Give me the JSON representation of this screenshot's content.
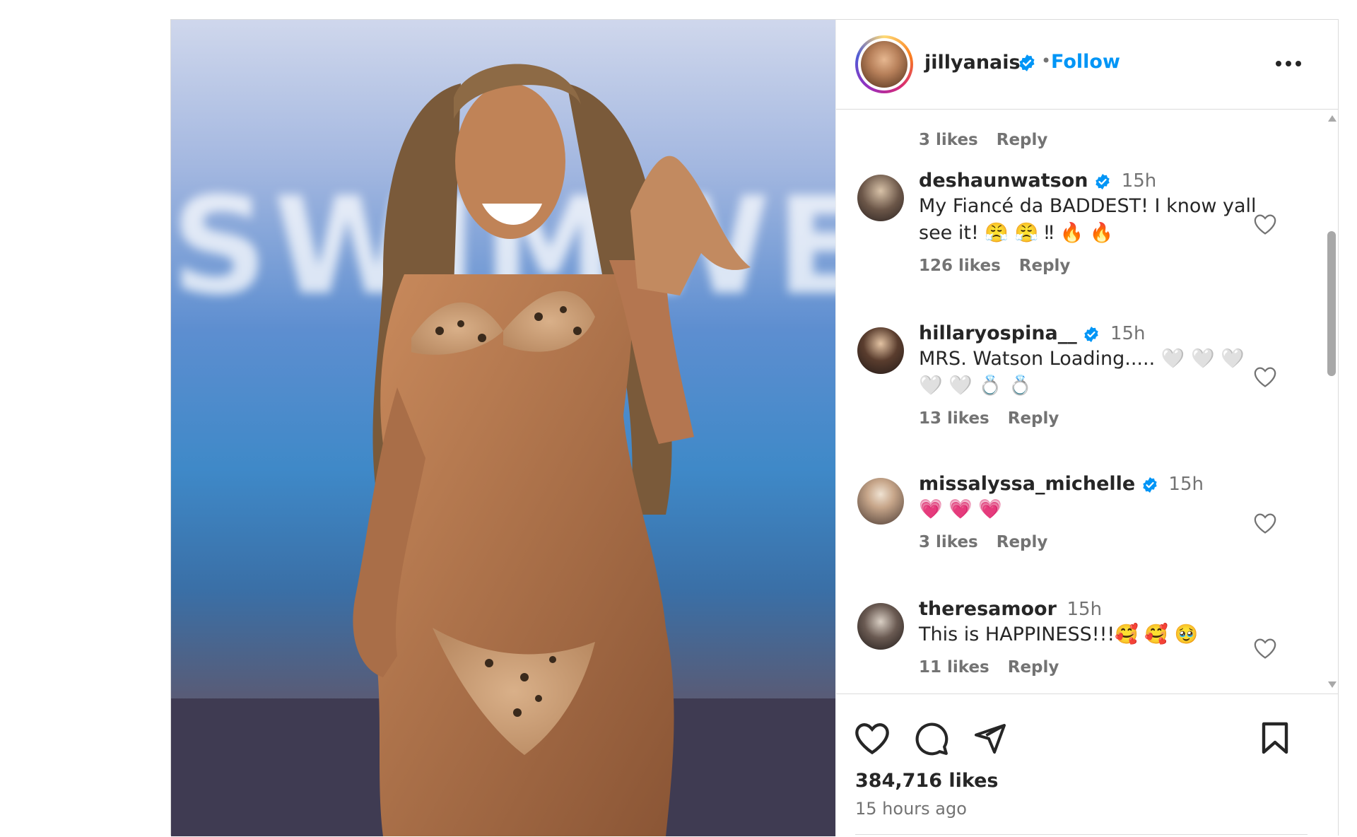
{
  "post": {
    "username": "jillyanais",
    "separator": "•",
    "follow_label": "Follow",
    "more_icon": "more-horizontal-icon",
    "media_text": "SWIMWEEK"
  },
  "top_meta": {
    "likes": "3 likes",
    "reply": "Reply"
  },
  "comments": [
    {
      "username": "deshaunwatson",
      "verified": true,
      "time": "15h",
      "text_line1": "My Fiancé da BADDEST! I know yall",
      "text_line2": "see it! 😤 😤 ‼ 🔥 🔥",
      "likes": "126 likes",
      "reply": "Reply"
    },
    {
      "username": "hillaryospina__",
      "verified": true,
      "time": "15h",
      "text_line1": "MRS. Watson Loading..... 🤍 🤍 🤍",
      "text_line2": "🤍 🤍 💍 💍",
      "likes": "13 likes",
      "reply": "Reply"
    },
    {
      "username": "missalyssa_michelle",
      "verified": true,
      "time": "15h",
      "text_line1": "💗 💗 💗",
      "text_line2": "",
      "likes": "3 likes",
      "reply": "Reply"
    },
    {
      "username": "theresamoor",
      "verified": false,
      "time": "15h",
      "text_line1": "This is HAPPINESS!!!🥰 🥰 🥹",
      "text_line2": "",
      "likes": "11 likes",
      "reply": "Reply"
    }
  ],
  "footer": {
    "likes": "384,716 likes",
    "time_ago": "15 hours ago"
  },
  "colors": {
    "accent": "#0095f6",
    "verified": "#0095f6",
    "muted": "#737373",
    "text": "#262626",
    "border": "#dbdbdb"
  }
}
